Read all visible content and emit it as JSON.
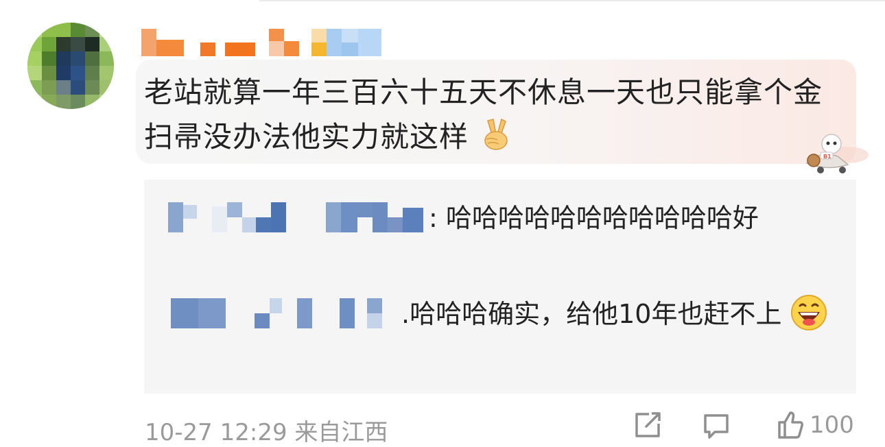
{
  "comment": {
    "username": "",
    "text": "老站就算一年三百六十五天不休息一天也只能拿个金扫帚没办法他实力就这样",
    "emoji": "victory-hand-emoji",
    "badge": "mascot-sticker"
  },
  "replies": [
    {
      "author": "",
      "separator": ": ",
      "text": "哈哈哈哈哈哈哈哈哈哈哈好"
    },
    {
      "author": "",
      "separator": ".",
      "text": "哈哈哈确实，给他10年也赶不上",
      "emoji": "grinning-face-emoji"
    }
  ],
  "meta": {
    "time": "10-27 12:29",
    "location": "来自江西",
    "like_count": "100"
  },
  "actions": {
    "share_icon": "share-icon",
    "comment_icon": "comment-icon",
    "like_icon": "like-icon"
  },
  "colors": {
    "text": "#222222",
    "meta": "#9a9a9a",
    "reply_bg": "#f5f5f5",
    "bubble_tint": "#fbe9e4"
  }
}
